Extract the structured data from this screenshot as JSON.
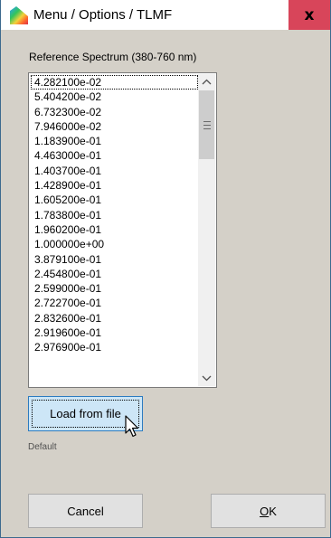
{
  "window": {
    "title": "Menu / Options / TLMF",
    "close_label": "x"
  },
  "spectrum": {
    "label": "Reference Spectrum (380-760 nm)",
    "values": [
      "4.282100e-02",
      "5.404200e-02",
      "6.732300e-02",
      "7.946000e-02",
      "1.183900e-01",
      "4.463000e-01",
      "1.403700e-01",
      "1.428900e-01",
      "1.605200e-01",
      "1.783800e-01",
      "1.960200e-01",
      "1.000000e+00",
      "3.879100e-01",
      "2.454800e-01",
      "2.599000e-01",
      "2.722700e-01",
      "2.832600e-01",
      "2.919600e-01",
      "2.976900e-01"
    ],
    "focused_index": 0
  },
  "buttons": {
    "load": "Load from file",
    "cancel": "Cancel",
    "ok_mnemonic": "O",
    "ok_rest": "K"
  },
  "status": {
    "default_label": "Default"
  },
  "colors": {
    "window_bg": "#d4d0c8",
    "close_bg": "#d8455a",
    "load_btn_bg": "#cde6f7"
  }
}
